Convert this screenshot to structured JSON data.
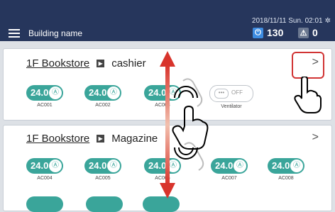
{
  "header": {
    "building_name": "Building name",
    "datetime": "2018/11/11 Sun. 02:01",
    "power_count": "130",
    "alarm_count": "0"
  },
  "cards": [
    {
      "location": "1F Bookstore",
      "room": "cashier",
      "units": [
        {
          "temp": "24.0",
          "label": "AC001"
        },
        {
          "temp": "24.0",
          "label": "AC002"
        },
        {
          "temp": "24.0",
          "label": "AC003"
        },
        {
          "type": "ventilator",
          "state": "OFF",
          "label": "Ventilator"
        }
      ]
    },
    {
      "location": "1F Bookstore",
      "room": "Magazine",
      "units": [
        {
          "temp": "24.0",
          "label": "AC004"
        },
        {
          "temp": "24.0",
          "label": "AC005"
        },
        {
          "temp": "24.0",
          "label": "AC006"
        },
        {
          "temp": "24.0",
          "label": "AC007"
        },
        {
          "temp": "24.0",
          "label": "AC008"
        }
      ]
    }
  ],
  "colors": {
    "header_bg": "#26365c",
    "ac_on": "#3aa59a",
    "highlight": "#d13434",
    "arrow": "#d8342c"
  },
  "icons": [
    "menu-icon",
    "power-icon",
    "alarm-icon",
    "gear-icon",
    "chevron-right-icon",
    "swipe-arrow-icon",
    "hand-gesture-icon"
  ]
}
